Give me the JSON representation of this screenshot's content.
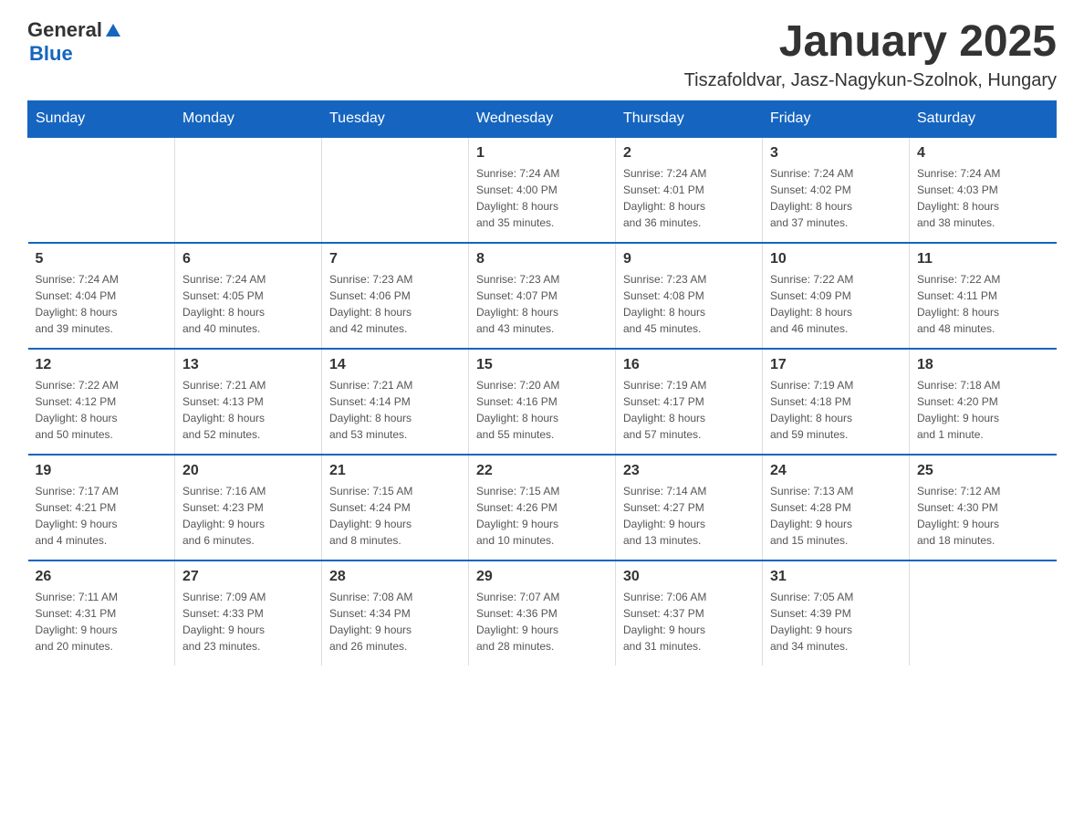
{
  "logo": {
    "text_general": "General",
    "triangle": "▶",
    "text_blue": "Blue"
  },
  "title": "January 2025",
  "subtitle": "Tiszafoldvar, Jasz-Nagykun-Szolnok, Hungary",
  "weekdays": [
    "Sunday",
    "Monday",
    "Tuesday",
    "Wednesday",
    "Thursday",
    "Friday",
    "Saturday"
  ],
  "weeks": [
    [
      {
        "day": "",
        "info": ""
      },
      {
        "day": "",
        "info": ""
      },
      {
        "day": "",
        "info": ""
      },
      {
        "day": "1",
        "info": "Sunrise: 7:24 AM\nSunset: 4:00 PM\nDaylight: 8 hours\nand 35 minutes."
      },
      {
        "day": "2",
        "info": "Sunrise: 7:24 AM\nSunset: 4:01 PM\nDaylight: 8 hours\nand 36 minutes."
      },
      {
        "day": "3",
        "info": "Sunrise: 7:24 AM\nSunset: 4:02 PM\nDaylight: 8 hours\nand 37 minutes."
      },
      {
        "day": "4",
        "info": "Sunrise: 7:24 AM\nSunset: 4:03 PM\nDaylight: 8 hours\nand 38 minutes."
      }
    ],
    [
      {
        "day": "5",
        "info": "Sunrise: 7:24 AM\nSunset: 4:04 PM\nDaylight: 8 hours\nand 39 minutes."
      },
      {
        "day": "6",
        "info": "Sunrise: 7:24 AM\nSunset: 4:05 PM\nDaylight: 8 hours\nand 40 minutes."
      },
      {
        "day": "7",
        "info": "Sunrise: 7:23 AM\nSunset: 4:06 PM\nDaylight: 8 hours\nand 42 minutes."
      },
      {
        "day": "8",
        "info": "Sunrise: 7:23 AM\nSunset: 4:07 PM\nDaylight: 8 hours\nand 43 minutes."
      },
      {
        "day": "9",
        "info": "Sunrise: 7:23 AM\nSunset: 4:08 PM\nDaylight: 8 hours\nand 45 minutes."
      },
      {
        "day": "10",
        "info": "Sunrise: 7:22 AM\nSunset: 4:09 PM\nDaylight: 8 hours\nand 46 minutes."
      },
      {
        "day": "11",
        "info": "Sunrise: 7:22 AM\nSunset: 4:11 PM\nDaylight: 8 hours\nand 48 minutes."
      }
    ],
    [
      {
        "day": "12",
        "info": "Sunrise: 7:22 AM\nSunset: 4:12 PM\nDaylight: 8 hours\nand 50 minutes."
      },
      {
        "day": "13",
        "info": "Sunrise: 7:21 AM\nSunset: 4:13 PM\nDaylight: 8 hours\nand 52 minutes."
      },
      {
        "day": "14",
        "info": "Sunrise: 7:21 AM\nSunset: 4:14 PM\nDaylight: 8 hours\nand 53 minutes."
      },
      {
        "day": "15",
        "info": "Sunrise: 7:20 AM\nSunset: 4:16 PM\nDaylight: 8 hours\nand 55 minutes."
      },
      {
        "day": "16",
        "info": "Sunrise: 7:19 AM\nSunset: 4:17 PM\nDaylight: 8 hours\nand 57 minutes."
      },
      {
        "day": "17",
        "info": "Sunrise: 7:19 AM\nSunset: 4:18 PM\nDaylight: 8 hours\nand 59 minutes."
      },
      {
        "day": "18",
        "info": "Sunrise: 7:18 AM\nSunset: 4:20 PM\nDaylight: 9 hours\nand 1 minute."
      }
    ],
    [
      {
        "day": "19",
        "info": "Sunrise: 7:17 AM\nSunset: 4:21 PM\nDaylight: 9 hours\nand 4 minutes."
      },
      {
        "day": "20",
        "info": "Sunrise: 7:16 AM\nSunset: 4:23 PM\nDaylight: 9 hours\nand 6 minutes."
      },
      {
        "day": "21",
        "info": "Sunrise: 7:15 AM\nSunset: 4:24 PM\nDaylight: 9 hours\nand 8 minutes."
      },
      {
        "day": "22",
        "info": "Sunrise: 7:15 AM\nSunset: 4:26 PM\nDaylight: 9 hours\nand 10 minutes."
      },
      {
        "day": "23",
        "info": "Sunrise: 7:14 AM\nSunset: 4:27 PM\nDaylight: 9 hours\nand 13 minutes."
      },
      {
        "day": "24",
        "info": "Sunrise: 7:13 AM\nSunset: 4:28 PM\nDaylight: 9 hours\nand 15 minutes."
      },
      {
        "day": "25",
        "info": "Sunrise: 7:12 AM\nSunset: 4:30 PM\nDaylight: 9 hours\nand 18 minutes."
      }
    ],
    [
      {
        "day": "26",
        "info": "Sunrise: 7:11 AM\nSunset: 4:31 PM\nDaylight: 9 hours\nand 20 minutes."
      },
      {
        "day": "27",
        "info": "Sunrise: 7:09 AM\nSunset: 4:33 PM\nDaylight: 9 hours\nand 23 minutes."
      },
      {
        "day": "28",
        "info": "Sunrise: 7:08 AM\nSunset: 4:34 PM\nDaylight: 9 hours\nand 26 minutes."
      },
      {
        "day": "29",
        "info": "Sunrise: 7:07 AM\nSunset: 4:36 PM\nDaylight: 9 hours\nand 28 minutes."
      },
      {
        "day": "30",
        "info": "Sunrise: 7:06 AM\nSunset: 4:37 PM\nDaylight: 9 hours\nand 31 minutes."
      },
      {
        "day": "31",
        "info": "Sunrise: 7:05 AM\nSunset: 4:39 PM\nDaylight: 9 hours\nand 34 minutes."
      },
      {
        "day": "",
        "info": ""
      }
    ]
  ]
}
